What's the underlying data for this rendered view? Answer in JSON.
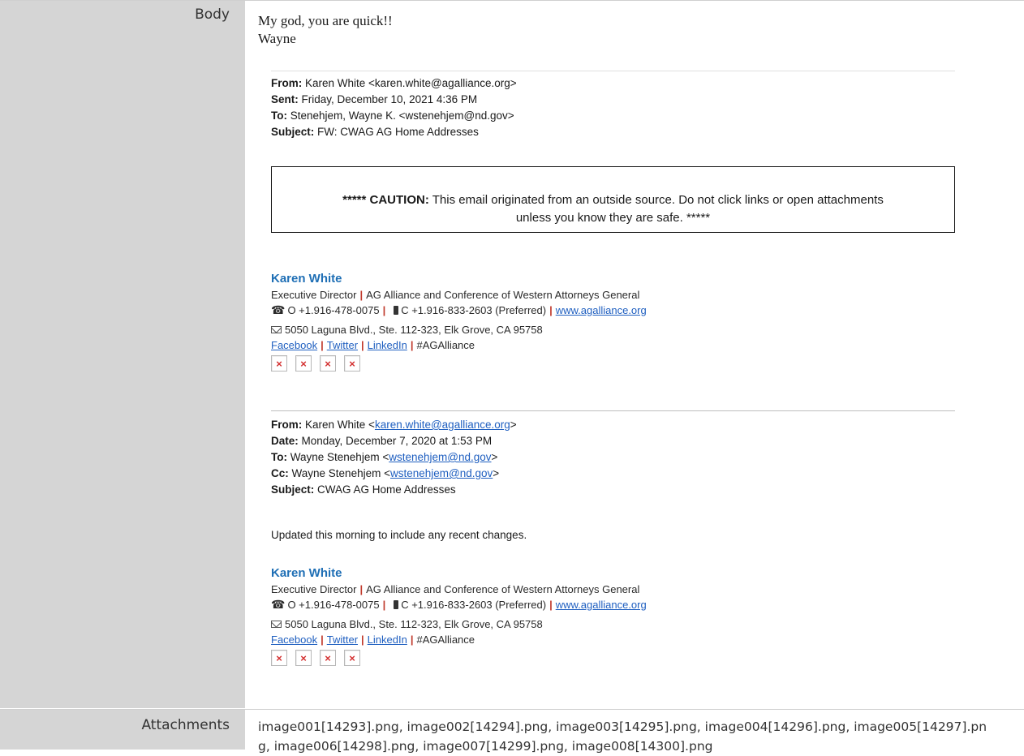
{
  "labels": {
    "body": "Body",
    "attachments": "Attachments"
  },
  "email": {
    "opening_line1": "My god, you are quick!!",
    "opening_line2": "Wayne",
    "header1": {
      "from_label": "From:",
      "from_value": "Karen White <karen.white@agalliance.org>",
      "sent_label": "Sent:",
      "sent_value": "Friday, December 10, 2021 4:36 PM",
      "to_label": "To:",
      "to_value": "Stenehjem, Wayne K. <wstenehjem@nd.gov>",
      "subject_label": "Subject:",
      "subject_value": "FW: CWAG AG Home Addresses"
    },
    "caution": {
      "stars_lead": "*****",
      "bold": "CAUTION:",
      "line1": "This email originated from an outside source. Do not click links or open attachments",
      "line2": "unless you know they are safe. *****"
    },
    "signature": {
      "name": "Karen White",
      "title": "Executive Director",
      "org": "AG Alliance and Conference of Western Attorneys General",
      "office": "O +1.916-478-0075",
      "cell": "C +1.916-833-2603 (Preferred)",
      "website": "www.agalliance.org",
      "address": "5050 Laguna Blvd., Ste. 112-323, Elk Grove, CA 95758",
      "facebook": "Facebook",
      "twitter": "Twitter",
      "linkedin": "LinkedIn",
      "hashtag": "#AGAlliance",
      "broken_image_glyph": "×"
    },
    "header2": {
      "from_label": "From:",
      "from_name": "Karen White <",
      "from_email": "karen.white@agalliance.org",
      "from_close": ">",
      "date_label": "Date:",
      "date_value": "Monday, December 7, 2020 at 1:53 PM",
      "to_label": "To:",
      "to_name": "Wayne Stenehjem <",
      "to_email": "wstenehjem@nd.gov",
      "to_close": ">",
      "cc_label": "Cc:",
      "cc_name": "Wayne Stenehjem <",
      "cc_email": "wstenehjem@nd.gov",
      "cc_close": ">",
      "subject_label": "Subject:",
      "subject_value": "CWAG AG Home Addresses"
    },
    "note": "Updated this morning to include any recent changes."
  },
  "attachments": {
    "text": "image001[14293].png, image002[14294].png, image003[14295].png, image004[14296].png, image005[14297].png, image006[14298].png, image007[14299].png, image008[14300].png"
  },
  "colors": {
    "label_bg": "#d5d5d5",
    "signature_name": "#1f6fb5",
    "pipe": "#c0392b",
    "link": "#1f5fc0",
    "broken_x": "#d32f2f"
  },
  "icons": [
    "phone-icon",
    "mobile-icon",
    "envelope-icon",
    "broken-image-icon"
  ]
}
